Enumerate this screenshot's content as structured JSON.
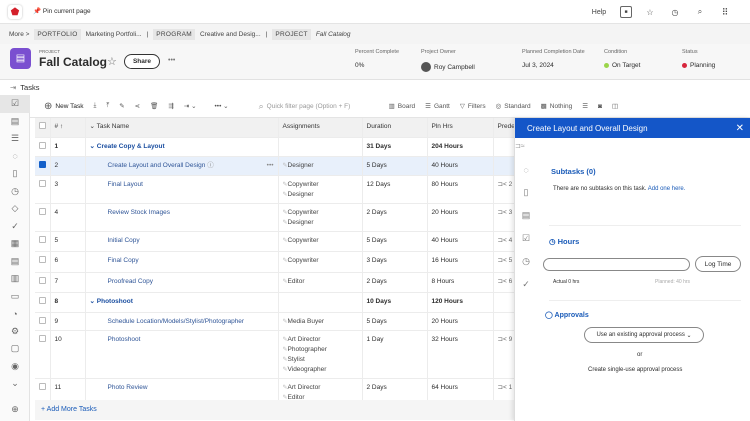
{
  "topbar": {
    "pin_label": "Pin current page",
    "help": "Help",
    "icons": [
      "notification-icon",
      "star-icon",
      "history-icon",
      "search-icon",
      "apps-grid-icon"
    ]
  },
  "breadcrumb": {
    "more": "More >",
    "items": [
      {
        "tag": "PORTFOLIO",
        "name": "Marketing Portfoli..."
      },
      {
        "tag": "PROGRAM",
        "name": "Creative and Desig..."
      },
      {
        "tag": "PROJECT",
        "name": "Fall Catalog"
      }
    ]
  },
  "project": {
    "type": "PROJECT",
    "title": "Fall Catalog",
    "share": "Share",
    "more": "•••",
    "meta": [
      {
        "label": "Percent Complete",
        "value": "0%"
      },
      {
        "label": "Project Owner",
        "value": "Roy Campbell"
      },
      {
        "label": "Planned Completion Date",
        "value": "Jul 3, 2024"
      },
      {
        "label": "Condition",
        "value": "On Target",
        "color": "#9bd54a"
      },
      {
        "label": "Status",
        "value": "Planning",
        "color": "#d7263d"
      }
    ]
  },
  "tasks_label": "Tasks",
  "toolbar": {
    "new_task": "New Task",
    "search_placeholder": "Quick filter page (Option + F)",
    "board": "Board",
    "gantt": "Gantt",
    "filters": "Filters",
    "standard": "Standard",
    "nothing": "Nothing"
  },
  "table": {
    "headers": {
      "num": "# ↑",
      "name": "Task Name",
      "assignments": "Assignments",
      "duration": "Duration",
      "pln_hrs": "Pln Hrs",
      "pred": "Prede"
    },
    "rows": [
      {
        "num": "1",
        "name": "Create Copy & Layout",
        "group": true,
        "assignments": [],
        "duration": "31 Days",
        "hours": "204 Hours",
        "pred": ""
      },
      {
        "num": "2",
        "name": "Create Layout and Overall Design",
        "selected": true,
        "assignments": [
          "Designer"
        ],
        "duration": "5 Days",
        "hours": "40 Hours",
        "pred": ""
      },
      {
        "num": "3",
        "name": "Final Layout",
        "assignments": [
          "Copywriter",
          "Designer"
        ],
        "duration": "12 Days",
        "hours": "80 Hours",
        "pred": "2"
      },
      {
        "num": "4",
        "name": "Review Stock Images",
        "assignments": [
          "Copywriter",
          "Designer"
        ],
        "duration": "2 Days",
        "hours": "20 Hours",
        "pred": "3"
      },
      {
        "num": "5",
        "name": "Initial Copy",
        "assignments": [
          "Copywriter"
        ],
        "duration": "5 Days",
        "hours": "40 Hours",
        "pred": "4"
      },
      {
        "num": "6",
        "name": "Final Copy",
        "assignments": [
          "Copywriter"
        ],
        "duration": "3 Days",
        "hours": "16 Hours",
        "pred": "5"
      },
      {
        "num": "7",
        "name": "Proofread Copy",
        "assignments": [
          "Editor"
        ],
        "duration": "2 Days",
        "hours": "8 Hours",
        "pred": "6"
      },
      {
        "num": "8",
        "name": "Photoshoot",
        "group": true,
        "assignments": [],
        "duration": "10 Days",
        "hours": "120 Hours",
        "pred": ""
      },
      {
        "num": "9",
        "name": "Schedule Location/Models/Stylist/Photographer",
        "assignments": [
          "Media Buyer"
        ],
        "duration": "5 Days",
        "hours": "20 Hours",
        "pred": ""
      },
      {
        "num": "10",
        "name": "Photoshoot",
        "assignments": [
          "Art Director",
          "Photographer",
          "Stylist",
          "Videographer"
        ],
        "duration": "1 Day",
        "hours": "32 Hours",
        "pred": "9"
      },
      {
        "num": "11",
        "name": "Photo Review",
        "assignments": [
          "Art Director",
          "Editor"
        ],
        "duration": "2 Days",
        "hours": "64 Hours",
        "pred": "1"
      }
    ],
    "add_more": "+ Add More Tasks"
  },
  "panel": {
    "title": "Create Layout and Overall Design",
    "subtasks_title": "Subtasks (0)",
    "subtasks_empty": "There are no subtasks on this task.",
    "add_one": "Add one here.",
    "hours_title": "Hours",
    "log_time": "Log Time",
    "actual": "Actual 0 hrs",
    "planned": "Planned: 40 hrs",
    "approvals_title": "Approvals",
    "use_existing": "Use an existing approval process",
    "or": "or",
    "single_use": "Create single-use approval process"
  }
}
